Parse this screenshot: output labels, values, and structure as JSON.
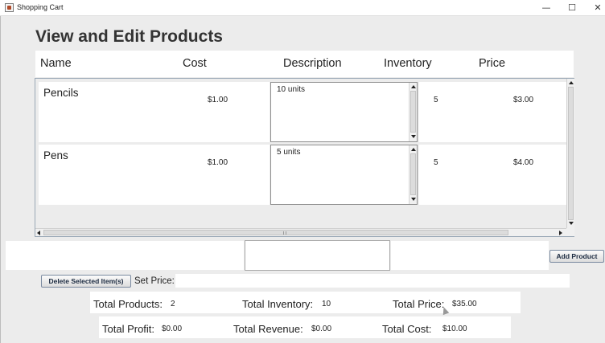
{
  "window": {
    "title": "Shopping Cart",
    "controls": {
      "minimize": "—",
      "maximize": "☐",
      "close": "✕"
    }
  },
  "page_title": "View and Edit Products",
  "columns": [
    "Name",
    "Cost",
    "Description",
    "Inventory",
    "Price"
  ],
  "products": [
    {
      "name": "Pencils",
      "cost": "$1.00",
      "description": "10 units",
      "inventory": "5",
      "price": "$3.00"
    },
    {
      "name": "Pens",
      "cost": "$1.00",
      "description": "5 units",
      "inventory": "5",
      "price": "$4.00"
    }
  ],
  "buttons": {
    "add_product": "Add Product",
    "delete_selected": "Delete Selected Item(s)"
  },
  "set_price": {
    "label": "Set Price:",
    "value": ""
  },
  "new_product": {
    "name": "",
    "description": "",
    "cost": ""
  },
  "totals": {
    "products_label": "Total Products:",
    "products_value": "2",
    "inventory_label": "Total Inventory:",
    "inventory_value": "10",
    "price_label": "Total Price:",
    "price_value": "$35.00",
    "profit_label": "Total Profit:",
    "profit_value": "$0.00",
    "revenue_label": "Total Revenue:",
    "revenue_value": "$0.00",
    "cost_label": "Total Cost:",
    "cost_value": "$10.00"
  }
}
